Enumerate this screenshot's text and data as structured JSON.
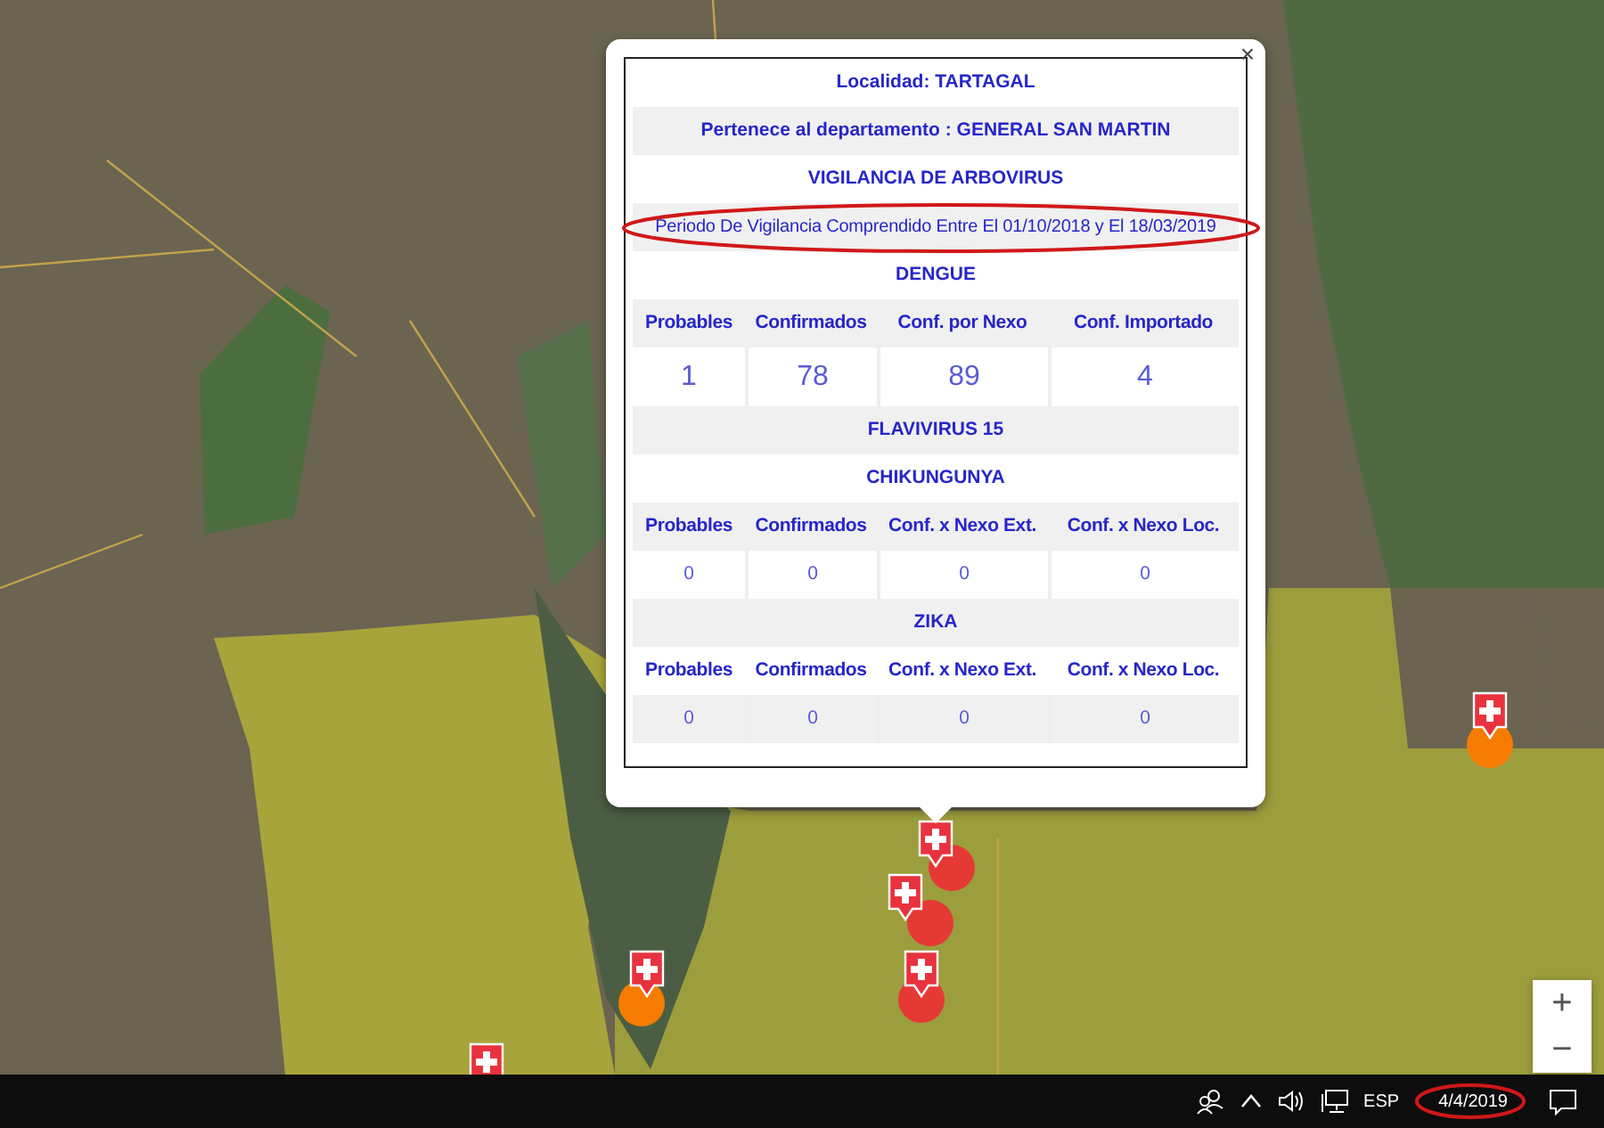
{
  "map": {
    "markers": [
      {
        "color": "#e53935"
      },
      {
        "color": "#e53935"
      },
      {
        "color": "#e53935"
      },
      {
        "color": "#f57c00"
      },
      {
        "color": "#f57c00"
      }
    ],
    "zoom_controls": [
      "+",
      "−"
    ]
  },
  "popup": {
    "close": "×",
    "rows": [
      {
        "kind": "heading",
        "text": "Localidad: TARTAGAL"
      },
      {
        "kind": "heading",
        "text": "Pertenece al departamento : GENERAL SAN MARTIN"
      },
      {
        "kind": "heading",
        "text": "VIGILANCIA DE ARBOVIRUS"
      },
      {
        "kind": "note",
        "text": "Periodo De Vigilancia Comprendido Entre El 01/10/2018 y El 18/03/2019",
        "circled": true
      },
      {
        "kind": "heading",
        "text": "DENGUE"
      },
      {
        "kind": "headers",
        "cells": [
          "Probables",
          "Confirmados",
          "Conf. por Nexo",
          "Conf. Importado"
        ]
      },
      {
        "kind": "big_values",
        "cells": [
          "1",
          "78",
          "89",
          "4"
        ]
      },
      {
        "kind": "heading",
        "text": "FLAVIVIRUS 15"
      },
      {
        "kind": "heading",
        "text": "CHIKUNGUNYA"
      },
      {
        "kind": "headers",
        "cells": [
          "Probables",
          "Confirmados",
          "Conf. x Nexo Ext.",
          "Conf. x Nexo Loc."
        ]
      },
      {
        "kind": "values",
        "cells": [
          "0",
          "0",
          "0",
          "0"
        ]
      },
      {
        "kind": "heading",
        "text": "ZIKA"
      },
      {
        "kind": "headers",
        "cells": [
          "Probables",
          "Confirmados",
          "Conf. x Nexo Ext.",
          "Conf. x Nexo Loc."
        ]
      },
      {
        "kind": "values",
        "cells": [
          "0",
          "0",
          "0",
          "0"
        ]
      }
    ]
  },
  "taskbar": {
    "language": "ESP",
    "date": {
      "text": "4/4/2019",
      "circled": true
    }
  }
}
